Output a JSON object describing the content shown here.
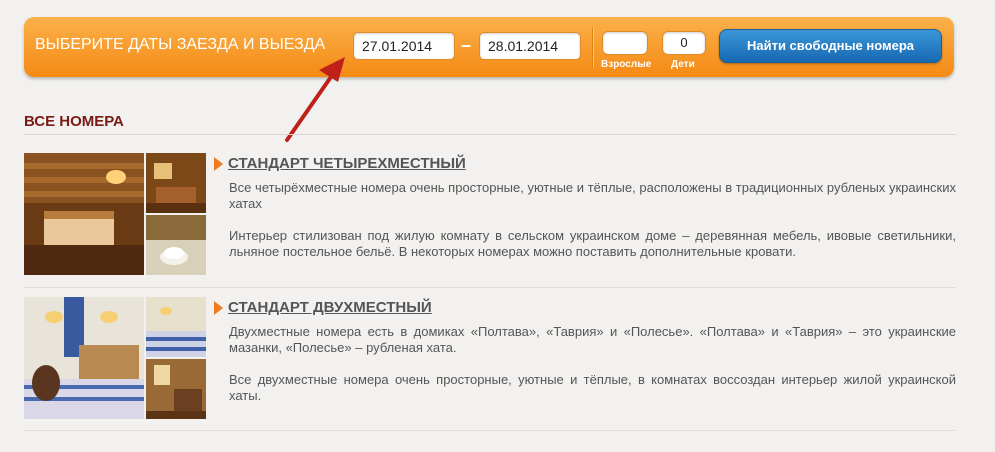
{
  "booking": {
    "title": "ВЫБЕРИТЕ ДАТЫ ЗАЕЗДА И ВЫЕЗДА",
    "date_from": "27.01.2014",
    "date_separator": "–",
    "date_to": "28.01.2014",
    "adults_value": "",
    "adults_label": "Взрослые",
    "children_value": "0",
    "children_label": "Дети",
    "search_button": "Найти свободные номера"
  },
  "section": {
    "title": "ВСЕ НОМЕРА"
  },
  "rooms": [
    {
      "title": "СТАНДАРТ ЧЕТЫРЕХМЕСТНЫЙ",
      "paragraphs": [
        "Все четырёхместные номера очень просторные, уютные и тёплые, расположены в традиционных рубленых украинских хатах",
        "Интерьер стилизован под жилую комнату в сельском украинском доме – деревянная мебель, ивовые светильники, льняное постельное бельё. В некоторых номерах можно поставить дополнительные кровати."
      ]
    },
    {
      "title": "СТАНДАРТ ДВУХМЕСТНЫЙ",
      "paragraphs": [
        "Двухместные номера есть в домиках «Полтава», «Таврия» и «Полесье». «Полтава» и «Таврия» – это украинские мазанки, «Полесье» – рубленая хата.",
        "Все двухместные номера очень просторные, уютные и тёплые, в комнатах воссоздан интерьер жилой украинской хаты."
      ]
    }
  ],
  "colors": {
    "bar_orange": "#f48a14",
    "button_blue": "#1768b2",
    "section_title": "#7a1a14",
    "arrow": "#c0201a"
  }
}
